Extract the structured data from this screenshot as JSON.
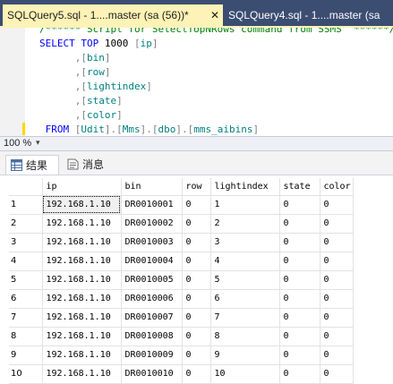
{
  "tabs": {
    "active_label": "SQLQuery5.sql - 1....master (sa (56))*",
    "inactive_label": "SQLQuery4.sql - 1....master (sa",
    "close_glyph": "✕"
  },
  "editor": {
    "lines": [
      {
        "parts": [
          {
            "c": "cm",
            "t": "/****** Script for SelectTopNRows command from SSMS  ******/"
          }
        ]
      },
      {
        "parts": [
          {
            "c": "kw",
            "t": "SELECT TOP "
          },
          {
            "c": "",
            "t": "1000 "
          },
          {
            "c": "gr",
            "t": "["
          },
          {
            "c": "id",
            "t": "ip"
          },
          {
            "c": "gr",
            "t": "]"
          }
        ]
      },
      {
        "parts": [
          {
            "c": "",
            "t": "      "
          },
          {
            "c": "gr",
            "t": ",["
          },
          {
            "c": "id",
            "t": "bin"
          },
          {
            "c": "gr",
            "t": "]"
          }
        ]
      },
      {
        "parts": [
          {
            "c": "",
            "t": "      "
          },
          {
            "c": "gr",
            "t": ",["
          },
          {
            "c": "id",
            "t": "row"
          },
          {
            "c": "gr",
            "t": "]"
          }
        ]
      },
      {
        "parts": [
          {
            "c": "",
            "t": "      "
          },
          {
            "c": "gr",
            "t": ",["
          },
          {
            "c": "id",
            "t": "lightindex"
          },
          {
            "c": "gr",
            "t": "]"
          }
        ]
      },
      {
        "parts": [
          {
            "c": "",
            "t": "      "
          },
          {
            "c": "gr",
            "t": ",["
          },
          {
            "c": "id",
            "t": "state"
          },
          {
            "c": "gr",
            "t": "]"
          }
        ]
      },
      {
        "parts": [
          {
            "c": "",
            "t": "      "
          },
          {
            "c": "gr",
            "t": ",["
          },
          {
            "c": "id",
            "t": "color"
          },
          {
            "c": "gr",
            "t": "]"
          }
        ]
      },
      {
        "parts": [
          {
            "c": "",
            "t": " "
          },
          {
            "c": "kw",
            "t": "FROM "
          },
          {
            "c": "gr",
            "t": "["
          },
          {
            "c": "id",
            "t": "Udit"
          },
          {
            "c": "gr",
            "t": "].["
          },
          {
            "c": "id",
            "t": "Mms"
          },
          {
            "c": "gr",
            "t": "].["
          },
          {
            "c": "id",
            "t": "dbo"
          },
          {
            "c": "gr",
            "t": "].["
          },
          {
            "c": "id",
            "t": "mms_aibins"
          },
          {
            "c": "gr",
            "t": "]"
          }
        ]
      }
    ]
  },
  "zoom": {
    "value": "100 %",
    "arrow": "▾"
  },
  "result_tabs": {
    "results": "结果",
    "messages": "消息"
  },
  "grid": {
    "columns": [
      "",
      "ip",
      "bin",
      "row",
      "lightindex",
      "state",
      "color"
    ],
    "rows": [
      [
        "1",
        "192.168.1.10",
        "DR0010001",
        "0",
        "1",
        "0",
        "0"
      ],
      [
        "2",
        "192.168.1.10",
        "DR0010002",
        "0",
        "2",
        "0",
        "0"
      ],
      [
        "3",
        "192.168.1.10",
        "DR0010003",
        "0",
        "3",
        "0",
        "0"
      ],
      [
        "4",
        "192.168.1.10",
        "DR0010004",
        "0",
        "4",
        "0",
        "0"
      ],
      [
        "5",
        "192.168.1.10",
        "DR0010005",
        "0",
        "5",
        "0",
        "0"
      ],
      [
        "6",
        "192.168.1.10",
        "DR0010006",
        "0",
        "6",
        "0",
        "0"
      ],
      [
        "7",
        "192.168.1.10",
        "DR0010007",
        "0",
        "7",
        "0",
        "0"
      ],
      [
        "8",
        "192.168.1.10",
        "DR0010008",
        "0",
        "8",
        "0",
        "0"
      ],
      [
        "9",
        "192.168.1.10",
        "DR0010009",
        "0",
        "9",
        "0",
        "0"
      ],
      [
        "10",
        "192.168.1.10",
        "DR0010010",
        "0",
        "10",
        "0",
        "0"
      ]
    ]
  },
  "colors": {
    "tab_bar": "#3c4d72",
    "active_tab": "#fdf3b6",
    "keyword": "#0000ff",
    "identifier": "#008080",
    "comment": "#008000"
  }
}
